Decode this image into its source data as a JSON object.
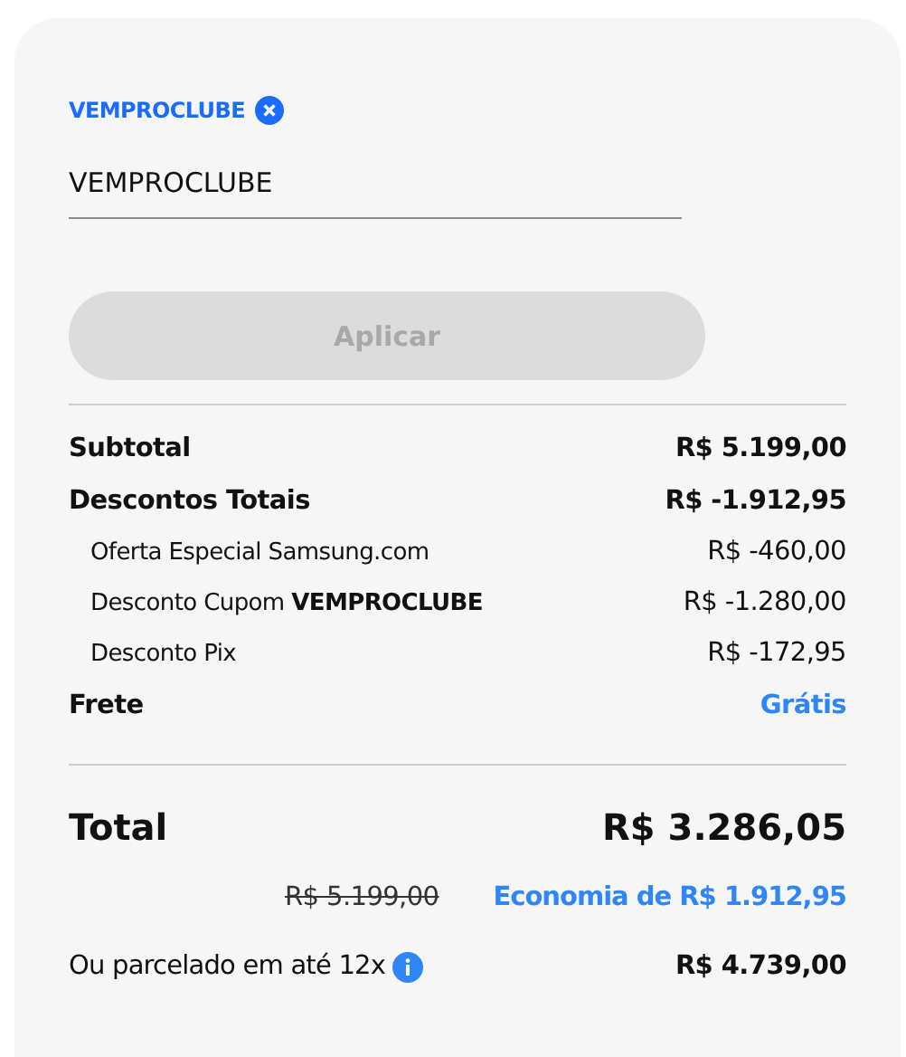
{
  "coupon": {
    "label": "VEMPROCLUBE"
  },
  "code_field": {
    "value": "VEMPROCLUBE"
  },
  "apply_button": {
    "label": "Aplicar",
    "disabled": true
  },
  "summary": [
    {
      "kind": "main",
      "label": "Subtotal",
      "value": "R$ 5.199,00",
      "accent": false
    },
    {
      "kind": "main",
      "label": "Descontos Totais",
      "value": "R$ -1.912,95",
      "accent": false
    },
    {
      "kind": "sub",
      "label": "Oferta Especial Samsung.com",
      "value": "R$ -460,00",
      "accent": false
    },
    {
      "kind": "sub",
      "label": "Desconto Cupom **VEMPROCLUBE**",
      "value": "R$ -1.280,00",
      "accent": false
    },
    {
      "kind": "sub",
      "label": "Desconto Pix",
      "value": "R$ -172,95",
      "accent": false
    },
    {
      "kind": "main",
      "label": "Frete",
      "value": "Grátis",
      "accent": true
    }
  ],
  "total": {
    "label": "Total",
    "value": "R$ 3.286,05"
  },
  "savings": {
    "old_price": "R$ 5.199,00",
    "economy": "Economia de R$ 1.912,95"
  },
  "installments": {
    "label": "Ou parcelado em até 12x",
    "value": "R$ 4.739,00"
  }
}
